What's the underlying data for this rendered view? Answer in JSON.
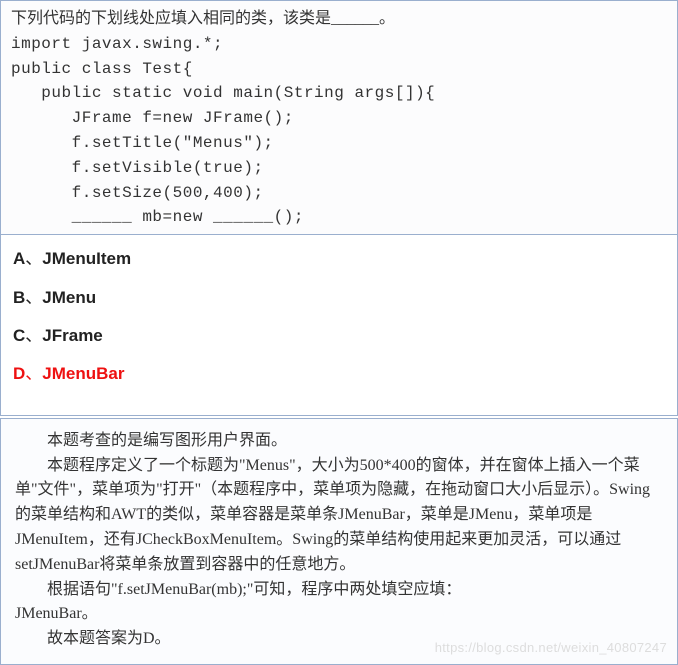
{
  "question": {
    "prompt": "下列代码的下划线处应填入相同的类，该类是______。",
    "code_lines": [
      "import javax.swing.*;",
      "public class Test{",
      "   public static void main(String args[]){",
      "      JFrame f=new JFrame();",
      "      f.setTitle(\"Menus\");",
      "      f.setVisible(true);",
      "      f.setSize(500,400);",
      "      ______ mb=new ______();"
    ]
  },
  "options": [
    {
      "letter": "A",
      "text": "JMenuItem",
      "correct": false
    },
    {
      "letter": "B",
      "text": "JMenu",
      "correct": false
    },
    {
      "letter": "C",
      "text": "JFrame",
      "correct": false
    },
    {
      "letter": "D",
      "text": "JMenuBar",
      "correct": true
    }
  ],
  "explanation": {
    "p1": "本题考查的是编写图形用户界面。",
    "p2": "本题程序定义了一个标题为\"Menus\"，大小为500*400的窗体，并在窗体上插入一个菜单\"文件\"，菜单项为\"打开\"（本题程序中，菜单项为隐藏，在拖动窗口大小后显示）。Swing的菜单结构和AWT的类似，菜单容器是菜单条JMenuBar，菜单是JMenu，菜单项是JMenuItem，还有JCheckBoxMenuItem。Swing的菜单结构使用起来更加灵活，可以通过setJMenuBar将菜单条放置到容器中的任意地方。",
    "p3a": "根据语句\"f.setJMenuBar(mb);\"可知，程序中两处填空应填：",
    "p3b": "JMenuBar。",
    "p4": "故本题答案为D。"
  },
  "watermark": "https://blog.csdn.net/weixin_40807247"
}
